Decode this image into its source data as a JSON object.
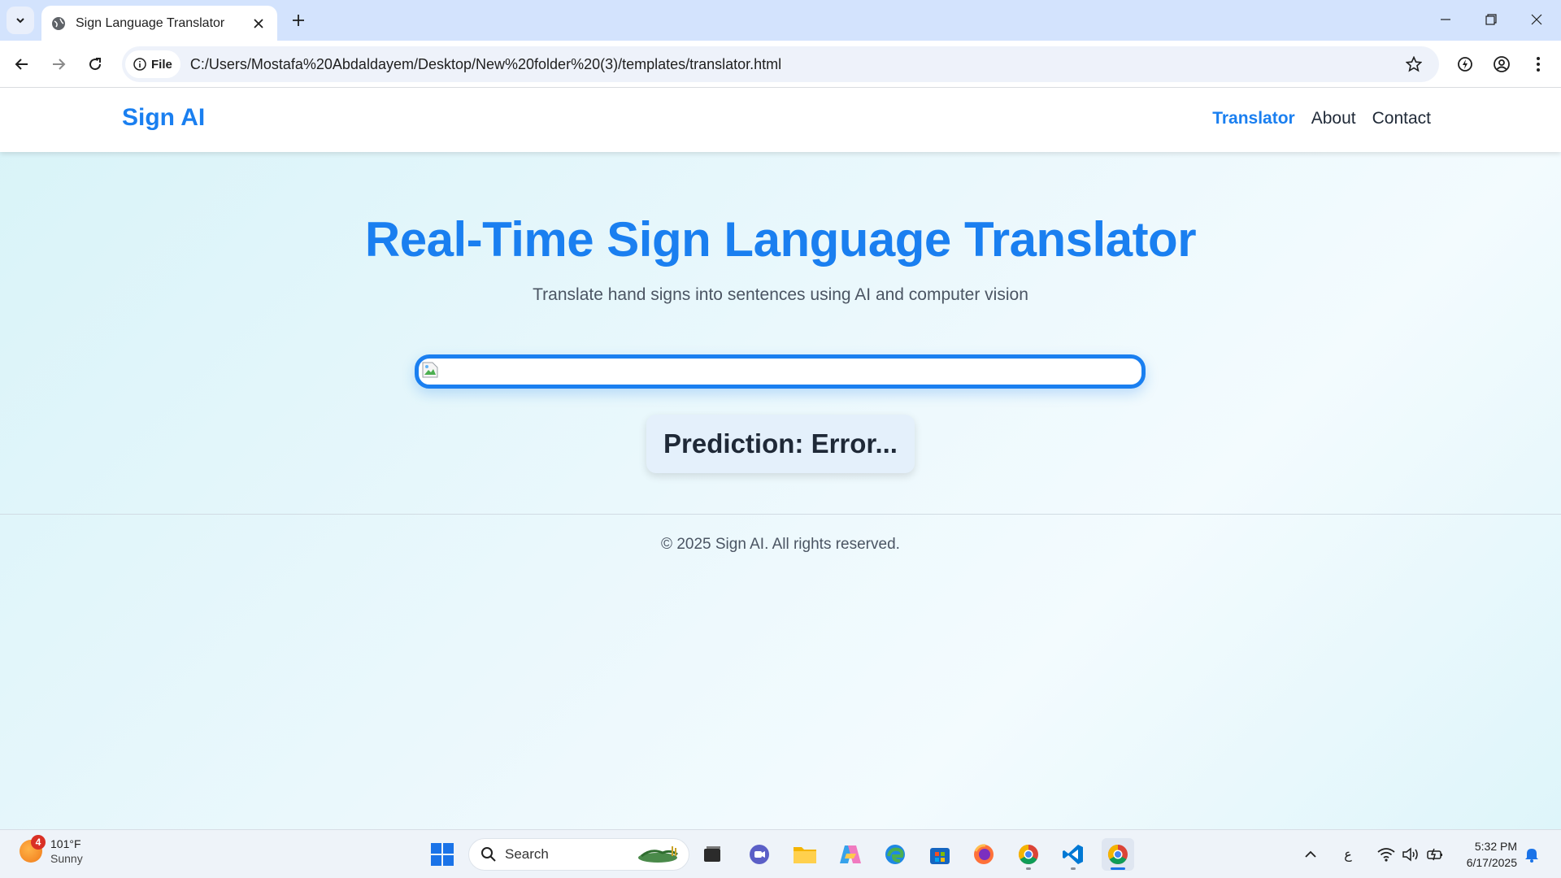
{
  "browser": {
    "tab_title": "Sign Language Translator",
    "address_chip": "File",
    "url": "C:/Users/Mostafa%20Abdaldayem/Desktop/New%20folder%20(3)/templates/translator.html"
  },
  "site": {
    "brand": "Sign AI",
    "nav": [
      {
        "label": "Translator",
        "active": true
      },
      {
        "label": "About",
        "active": false
      },
      {
        "label": "Contact",
        "active": false
      }
    ],
    "hero_title": "Real-Time Sign Language Translator",
    "hero_subtitle": "Translate hand signs into sentences using AI and computer vision",
    "prediction_text": "Prediction: Error...",
    "footer": "© 2025 Sign AI. All rights reserved.",
    "accent_color": "#1a7ff0"
  },
  "taskbar": {
    "weather_badge": "4",
    "weather_temp": "101°F",
    "weather_condition": "Sunny",
    "search_label": "Search",
    "language_indicator": "ع",
    "time": "5:32 PM",
    "date": "6/17/2025"
  }
}
